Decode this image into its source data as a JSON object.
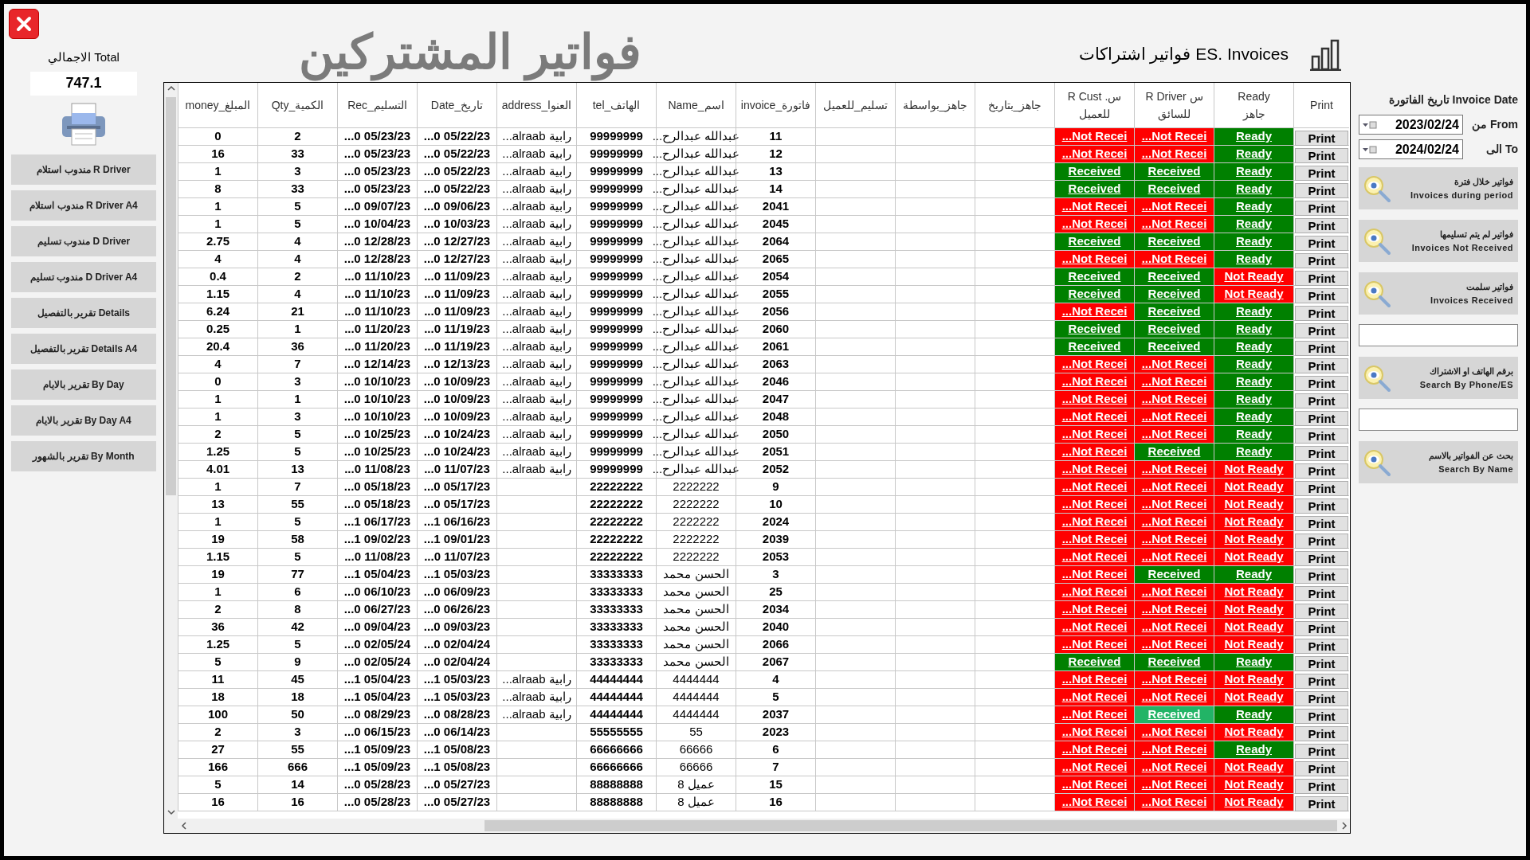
{
  "left_panel": {
    "total_label": "الاجمالي Total",
    "total_value": "747.1",
    "buttons": [
      "مندوب استلام  R Driver",
      "مندوب استلام R Driver A4",
      "مندوب تسليم  D Driver",
      "مندوب تسليم D Driver A4",
      "تقرير بالتفصيل Details",
      "تقرير بالتفصيل Details A4",
      "تقرير بالايام By Day",
      "تقرير بالايام By Day A4",
      "تقرير بالشهور By Month"
    ]
  },
  "title": "فواتير المشتركين",
  "subtitle": "فواتير اشتراكات ES. Invoices",
  "filter": {
    "heading": "تاريخ الفاتورة Invoice Date",
    "from": {
      "label": "من From",
      "value": "2023/02/24"
    },
    "to": {
      "label": "الى To",
      "value": "2024/02/24"
    }
  },
  "actions": [
    {
      "kind": "button",
      "arabic": "فواتير خلال فترة",
      "english": "Invoices during period"
    },
    {
      "kind": "button",
      "arabic": "فواتير لم يتم تسليمها",
      "english": "Invoices Not Received"
    },
    {
      "kind": "button",
      "arabic": "فواتير سلمت",
      "english": "Invoices Received"
    },
    {
      "kind": "field"
    },
    {
      "kind": "button",
      "arabic": "برقم الهاتف او الاشتراك",
      "english": "Search By Phone/ES"
    },
    {
      "kind": "field"
    },
    {
      "kind": "button",
      "arabic": "بحث عن الفواتير بالاسم",
      "english": "Search By Name"
    }
  ],
  "table": {
    "columns": [
      "Print",
      "Ready\nجاهز",
      "R Driver س\nللسائق",
      "R Cust .س\nللعميل",
      "جاهز_بتاريخ",
      "جاهز_بواسطة",
      "تسليم_للعميل",
      "invoice_فاتورة",
      "Name_اسم",
      "tel_الهاتف",
      "address_العنوا",
      "Date_تاريخ",
      "Rec_التسليم",
      "Qty_الكمية",
      "money_المبلغ"
    ],
    "rows": [
      {
        "money": "0",
        "qty": "2",
        "rec": "...0 05/23/23",
        "date": "...0 05/22/23",
        "address": "رابية alraab...",
        "tel": "99999999",
        "name": "عبدالله عبدالرح...",
        "invoice": "11",
        "cust_received": false,
        "cust_text": "...Not Recei",
        "driver_received": false,
        "driver_text": "...Not Recei",
        "focused": false,
        "ready": true,
        "ready_text": "Ready",
        "print": "Print"
      },
      {
        "money": "16",
        "qty": "33",
        "rec": "...0 05/23/23",
        "date": "...0 05/22/23",
        "address": "رابية alraab...",
        "tel": "99999999",
        "name": "عبدالله عبدالرح...",
        "invoice": "12",
        "cust_received": false,
        "cust_text": "...Not Recei",
        "driver_received": false,
        "driver_text": "...Not Recei",
        "focused": false,
        "ready": true,
        "ready_text": "Ready",
        "print": "Print"
      },
      {
        "money": "1",
        "qty": "3",
        "rec": "...0 05/23/23",
        "date": "...0 05/22/23",
        "address": "رابية alraab...",
        "tel": "99999999",
        "name": "عبدالله عبدالرح...",
        "invoice": "13",
        "cust_received": true,
        "cust_text": "Received",
        "driver_received": true,
        "driver_text": "Received",
        "focused": false,
        "ready": true,
        "ready_text": "Ready",
        "print": "Print"
      },
      {
        "money": "8",
        "qty": "33",
        "rec": "...0 05/23/23",
        "date": "...0 05/22/23",
        "address": "رابية alraab...",
        "tel": "99999999",
        "name": "عبدالله عبدالرح...",
        "invoice": "14",
        "cust_received": true,
        "cust_text": "Received",
        "driver_received": true,
        "driver_text": "Received",
        "focused": false,
        "ready": true,
        "ready_text": "Ready",
        "print": "Print"
      },
      {
        "money": "1",
        "qty": "5",
        "rec": "...0 09/07/23",
        "date": "...0 09/06/23",
        "address": "رابية alraab...",
        "tel": "99999999",
        "name": "عبدالله عبدالرح...",
        "invoice": "2041",
        "cust_received": false,
        "cust_text": "...Not Recei",
        "driver_received": false,
        "driver_text": "...Not Recei",
        "focused": false,
        "ready": true,
        "ready_text": "Ready",
        "print": "Print"
      },
      {
        "money": "1",
        "qty": "5",
        "rec": "...0 10/04/23",
        "date": "...0 10/03/23",
        "address": "رابية alraab...",
        "tel": "99999999",
        "name": "عبدالله عبدالرح...",
        "invoice": "2045",
        "cust_received": false,
        "cust_text": "...Not Recei",
        "driver_received": false,
        "driver_text": "...Not Recei",
        "focused": false,
        "ready": true,
        "ready_text": "Ready",
        "print": "Print"
      },
      {
        "money": "2.75",
        "qty": "4",
        "rec": "...0 12/28/23",
        "date": "...0 12/27/23",
        "address": "رابية alraab...",
        "tel": "99999999",
        "name": "عبدالله عبدالرح...",
        "invoice": "2064",
        "cust_received": true,
        "cust_text": "Received",
        "driver_received": true,
        "driver_text": "Received",
        "focused": false,
        "ready": true,
        "ready_text": "Ready",
        "print": "Print"
      },
      {
        "money": "4",
        "qty": "4",
        "rec": "...0 12/28/23",
        "date": "...0 12/27/23",
        "address": "رابية alraab...",
        "tel": "99999999",
        "name": "عبدالله عبدالرح...",
        "invoice": "2065",
        "cust_received": false,
        "cust_text": "...Not Recei",
        "driver_received": false,
        "driver_text": "...Not Recei",
        "focused": false,
        "ready": true,
        "ready_text": "Ready",
        "print": "Print"
      },
      {
        "money": "0.4",
        "qty": "2",
        "rec": "...0 11/10/23",
        "date": "...0 11/09/23",
        "address": "رابية alraab...",
        "tel": "99999999",
        "name": "عبدالله عبدالرح...",
        "invoice": "2054",
        "cust_received": true,
        "cust_text": "Received",
        "driver_received": true,
        "driver_text": "Received",
        "focused": false,
        "ready": false,
        "ready_text": "Not Ready",
        "print": "Print"
      },
      {
        "money": "1.15",
        "qty": "4",
        "rec": "...0 11/10/23",
        "date": "...0 11/09/23",
        "address": "رابية alraab...",
        "tel": "99999999",
        "name": "عبدالله عبدالرح...",
        "invoice": "2055",
        "cust_received": true,
        "cust_text": "Received",
        "driver_received": true,
        "driver_text": "Received",
        "focused": false,
        "ready": false,
        "ready_text": "Not Ready",
        "print": "Print"
      },
      {
        "money": "6.24",
        "qty": "21",
        "rec": "...0 11/10/23",
        "date": "...0 11/09/23",
        "address": "رابية alraab...",
        "tel": "99999999",
        "name": "عبدالله عبدالرح...",
        "invoice": "2056",
        "cust_received": false,
        "cust_text": "...Not Recei",
        "driver_received": true,
        "driver_text": "Received",
        "focused": false,
        "ready": true,
        "ready_text": "Ready",
        "print": "Print"
      },
      {
        "money": "0.25",
        "qty": "1",
        "rec": "...0 11/20/23",
        "date": "...0 11/19/23",
        "address": "رابية alraab...",
        "tel": "99999999",
        "name": "عبدالله عبدالرح...",
        "invoice": "2060",
        "cust_received": true,
        "cust_text": "Received",
        "driver_received": true,
        "driver_text": "Received",
        "focused": false,
        "ready": true,
        "ready_text": "Ready",
        "print": "Print"
      },
      {
        "money": "20.4",
        "qty": "36",
        "rec": "...0 11/20/23",
        "date": "...0 11/19/23",
        "address": "رابية alraab...",
        "tel": "99999999",
        "name": "عبدالله عبدالرح...",
        "invoice": "2061",
        "cust_received": true,
        "cust_text": "Received",
        "driver_received": true,
        "driver_text": "Received",
        "focused": false,
        "ready": true,
        "ready_text": "Ready",
        "print": "Print"
      },
      {
        "money": "4",
        "qty": "7",
        "rec": "...0 12/14/23",
        "date": "...0 12/13/23",
        "address": "رابية alraab...",
        "tel": "99999999",
        "name": "عبدالله عبدالرح...",
        "invoice": "2063",
        "cust_received": false,
        "cust_text": "...Not Recei",
        "driver_received": false,
        "driver_text": "...Not Recei",
        "focused": false,
        "ready": true,
        "ready_text": "Ready",
        "print": "Print"
      },
      {
        "money": "0",
        "qty": "3",
        "rec": "...0 10/10/23",
        "date": "...0 10/09/23",
        "address": "رابية alraab...",
        "tel": "99999999",
        "name": "عبدالله عبدالرح...",
        "invoice": "2046",
        "cust_received": false,
        "cust_text": "...Not Recei",
        "driver_received": false,
        "driver_text": "...Not Recei",
        "focused": false,
        "ready": true,
        "ready_text": "Ready",
        "print": "Print"
      },
      {
        "money": "1",
        "qty": "1",
        "rec": "...0 10/10/23",
        "date": "...0 10/09/23",
        "address": "رابية alraab...",
        "tel": "99999999",
        "name": "عبدالله عبدالرح...",
        "invoice": "2047",
        "cust_received": false,
        "cust_text": "...Not Recei",
        "driver_received": false,
        "driver_text": "...Not Recei",
        "focused": false,
        "ready": true,
        "ready_text": "Ready",
        "print": "Print"
      },
      {
        "money": "1",
        "qty": "3",
        "rec": "...0 10/10/23",
        "date": "...0 10/09/23",
        "address": "رابية alraab...",
        "tel": "99999999",
        "name": "عبدالله عبدالرح...",
        "invoice": "2048",
        "cust_received": false,
        "cust_text": "...Not Recei",
        "driver_received": false,
        "driver_text": "...Not Recei",
        "focused": false,
        "ready": true,
        "ready_text": "Ready",
        "print": "Print"
      },
      {
        "money": "2",
        "qty": "5",
        "rec": "...0 10/25/23",
        "date": "...0 10/24/23",
        "address": "رابية alraab...",
        "tel": "99999999",
        "name": "عبدالله عبدالرح...",
        "invoice": "2050",
        "cust_received": false,
        "cust_text": "...Not Recei",
        "driver_received": false,
        "driver_text": "...Not Recei",
        "focused": false,
        "ready": true,
        "ready_text": "Ready",
        "print": "Print"
      },
      {
        "money": "1.25",
        "qty": "5",
        "rec": "...0 10/25/23",
        "date": "...0 10/24/23",
        "address": "رابية alraab...",
        "tel": "99999999",
        "name": "عبدالله عبدالرح...",
        "invoice": "2051",
        "cust_received": false,
        "cust_text": "...Not Recei",
        "driver_received": true,
        "driver_text": "Received",
        "focused": false,
        "ready": true,
        "ready_text": "Ready",
        "print": "Print"
      },
      {
        "money": "4.01",
        "qty": "13",
        "rec": "...0 11/08/23",
        "date": "...0 11/07/23",
        "address": "رابية alraab...",
        "tel": "99999999",
        "name": "عبدالله عبدالرح...",
        "invoice": "2052",
        "cust_received": false,
        "cust_text": "...Not Recei",
        "driver_received": false,
        "driver_text": "...Not Recei",
        "focused": false,
        "ready": false,
        "ready_text": "Not Ready",
        "print": "Print"
      },
      {
        "money": "1",
        "qty": "7",
        "rec": "...0 05/18/23",
        "date": "...0 05/17/23",
        "address": "",
        "tel": "22222222",
        "name": "2222222",
        "invoice": "9",
        "cust_received": false,
        "cust_text": "...Not Recei",
        "driver_received": false,
        "driver_text": "...Not Recei",
        "focused": false,
        "ready": false,
        "ready_text": "Not Ready",
        "print": "Print"
      },
      {
        "money": "13",
        "qty": "55",
        "rec": "...0 05/18/23",
        "date": "...0 05/17/23",
        "address": "",
        "tel": "22222222",
        "name": "2222222",
        "invoice": "10",
        "cust_received": false,
        "cust_text": "...Not Recei",
        "driver_received": false,
        "driver_text": "...Not Recei",
        "focused": false,
        "ready": false,
        "ready_text": "Not Ready",
        "print": "Print"
      },
      {
        "money": "1",
        "qty": "5",
        "rec": "...1 06/17/23",
        "date": "...1 06/16/23",
        "address": "",
        "tel": "22222222",
        "name": "2222222",
        "invoice": "2024",
        "cust_received": false,
        "cust_text": "...Not Recei",
        "driver_received": false,
        "driver_text": "...Not Recei",
        "focused": false,
        "ready": false,
        "ready_text": "Not Ready",
        "print": "Print"
      },
      {
        "money": "19",
        "qty": "58",
        "rec": "...1 09/02/23",
        "date": "...1 09/01/23",
        "address": "",
        "tel": "22222222",
        "name": "2222222",
        "invoice": "2039",
        "cust_received": false,
        "cust_text": "...Not Recei",
        "driver_received": false,
        "driver_text": "...Not Recei",
        "focused": false,
        "ready": false,
        "ready_text": "Not Ready",
        "print": "Print"
      },
      {
        "money": "1.15",
        "qty": "5",
        "rec": "...0 11/08/23",
        "date": "...0 11/07/23",
        "address": "",
        "tel": "22222222",
        "name": "2222222",
        "invoice": "2053",
        "cust_received": false,
        "cust_text": "...Not Recei",
        "driver_received": false,
        "driver_text": "...Not Recei",
        "focused": false,
        "ready": false,
        "ready_text": "Not Ready",
        "print": "Print"
      },
      {
        "money": "19",
        "qty": "77",
        "rec": "...1 05/04/23",
        "date": "...1 05/03/23",
        "address": "",
        "tel": "33333333",
        "name": "الحسن محمد",
        "invoice": "3",
        "cust_received": false,
        "cust_text": "...Not Recei",
        "driver_received": true,
        "driver_text": "Received",
        "focused": false,
        "ready": true,
        "ready_text": "Ready",
        "print": "Print"
      },
      {
        "money": "1",
        "qty": "6",
        "rec": "...0 06/10/23",
        "date": "...0 06/09/23",
        "address": "",
        "tel": "33333333",
        "name": "الحسن محمد",
        "invoice": "25",
        "cust_received": false,
        "cust_text": "...Not Recei",
        "driver_received": false,
        "driver_text": "...Not Recei",
        "focused": false,
        "ready": false,
        "ready_text": "Not Ready",
        "print": "Print"
      },
      {
        "money": "2",
        "qty": "8",
        "rec": "...0 06/27/23",
        "date": "...0 06/26/23",
        "address": "",
        "tel": "33333333",
        "name": "الحسن محمد",
        "invoice": "2034",
        "cust_received": false,
        "cust_text": "...Not Recei",
        "driver_received": false,
        "driver_text": "...Not Recei",
        "focused": false,
        "ready": false,
        "ready_text": "Not Ready",
        "print": "Print"
      },
      {
        "money": "36",
        "qty": "42",
        "rec": "...0 09/04/23",
        "date": "...0 09/03/23",
        "address": "",
        "tel": "33333333",
        "name": "الحسن محمد",
        "invoice": "2040",
        "cust_received": false,
        "cust_text": "...Not Recei",
        "driver_received": false,
        "driver_text": "...Not Recei",
        "focused": false,
        "ready": false,
        "ready_text": "Not Ready",
        "print": "Print"
      },
      {
        "money": "1.25",
        "qty": "5",
        "rec": "...0 02/05/24",
        "date": "...0 02/04/24",
        "address": "",
        "tel": "33333333",
        "name": "الحسن محمد",
        "invoice": "2066",
        "cust_received": false,
        "cust_text": "...Not Recei",
        "driver_received": false,
        "driver_text": "...Not Recei",
        "focused": false,
        "ready": false,
        "ready_text": "Not Ready",
        "print": "Print"
      },
      {
        "money": "5",
        "qty": "9",
        "rec": "...0 02/05/24",
        "date": "...0 02/04/24",
        "address": "",
        "tel": "33333333",
        "name": "الحسن محمد",
        "invoice": "2067",
        "cust_received": true,
        "cust_text": "Received",
        "driver_received": true,
        "driver_text": "Received",
        "focused": false,
        "ready": true,
        "ready_text": "Ready",
        "print": "Print"
      },
      {
        "money": "11",
        "qty": "45",
        "rec": "...1 05/04/23",
        "date": "...1 05/03/23",
        "address": "رابية alraab...",
        "tel": "44444444",
        "name": "4444444",
        "invoice": "4",
        "cust_received": false,
        "cust_text": "...Not Recei",
        "driver_received": false,
        "driver_text": "...Not Recei",
        "focused": false,
        "ready": false,
        "ready_text": "Not Ready",
        "print": "Print"
      },
      {
        "money": "18",
        "qty": "18",
        "rec": "...1 05/04/23",
        "date": "...1 05/03/23",
        "address": "رابية alraab...",
        "tel": "44444444",
        "name": "4444444",
        "invoice": "5",
        "cust_received": false,
        "cust_text": "...Not Recei",
        "driver_received": false,
        "driver_text": "...Not Recei",
        "focused": false,
        "ready": false,
        "ready_text": "Not Ready",
        "print": "Print"
      },
      {
        "money": "100",
        "qty": "50",
        "rec": "...0 08/29/23",
        "date": "...0 08/28/23",
        "address": "رابية alraab...",
        "tel": "44444444",
        "name": "4444444",
        "invoice": "2037",
        "cust_received": false,
        "cust_text": "...Not Recei",
        "driver_received": true,
        "driver_text": "Received",
        "focused": true,
        "ready": true,
        "ready_text": "Ready",
        "print": "Print"
      },
      {
        "money": "2",
        "qty": "3",
        "rec": "...0 06/15/23",
        "date": "...0 06/14/23",
        "address": "",
        "tel": "55555555",
        "name": "55",
        "invoice": "2023",
        "cust_received": false,
        "cust_text": "...Not Recei",
        "driver_received": false,
        "driver_text": "...Not Recei",
        "focused": false,
        "ready": false,
        "ready_text": "Not Ready",
        "print": "Print"
      },
      {
        "money": "27",
        "qty": "55",
        "rec": "...1 05/09/23",
        "date": "...1 05/08/23",
        "address": "",
        "tel": "66666666",
        "name": "66666",
        "invoice": "6",
        "cust_received": false,
        "cust_text": "...Not Recei",
        "driver_received": false,
        "driver_text": "...Not Recei",
        "focused": false,
        "ready": true,
        "ready_text": "Ready",
        "print": "Print"
      },
      {
        "money": "166",
        "qty": "666",
        "rec": "...1 05/09/23",
        "date": "...1 05/08/23",
        "address": "",
        "tel": "66666666",
        "name": "66666",
        "invoice": "7",
        "cust_received": false,
        "cust_text": "...Not Recei",
        "driver_received": false,
        "driver_text": "...Not Recei",
        "focused": false,
        "ready": false,
        "ready_text": "Not Ready",
        "print": "Print"
      },
      {
        "money": "5",
        "qty": "14",
        "rec": "...0 05/28/23",
        "date": "...0 05/27/23",
        "address": "",
        "tel": "88888888",
        "name": "عميل 8",
        "invoice": "15",
        "cust_received": false,
        "cust_text": "...Not Recei",
        "driver_received": false,
        "driver_text": "...Not Recei",
        "focused": false,
        "ready": false,
        "ready_text": "Not Ready",
        "print": "Print"
      },
      {
        "money": "16",
        "qty": "16",
        "rec": "...0 05/28/23",
        "date": "...0 05/27/23",
        "address": "",
        "tel": "88888888",
        "name": "عميل 8",
        "invoice": "16",
        "cust_received": false,
        "cust_text": "...Not Recei",
        "driver_received": false,
        "driver_text": "...Not Recei",
        "focused": false,
        "ready": false,
        "ready_text": "Not Ready",
        "print": "Print"
      }
    ]
  }
}
